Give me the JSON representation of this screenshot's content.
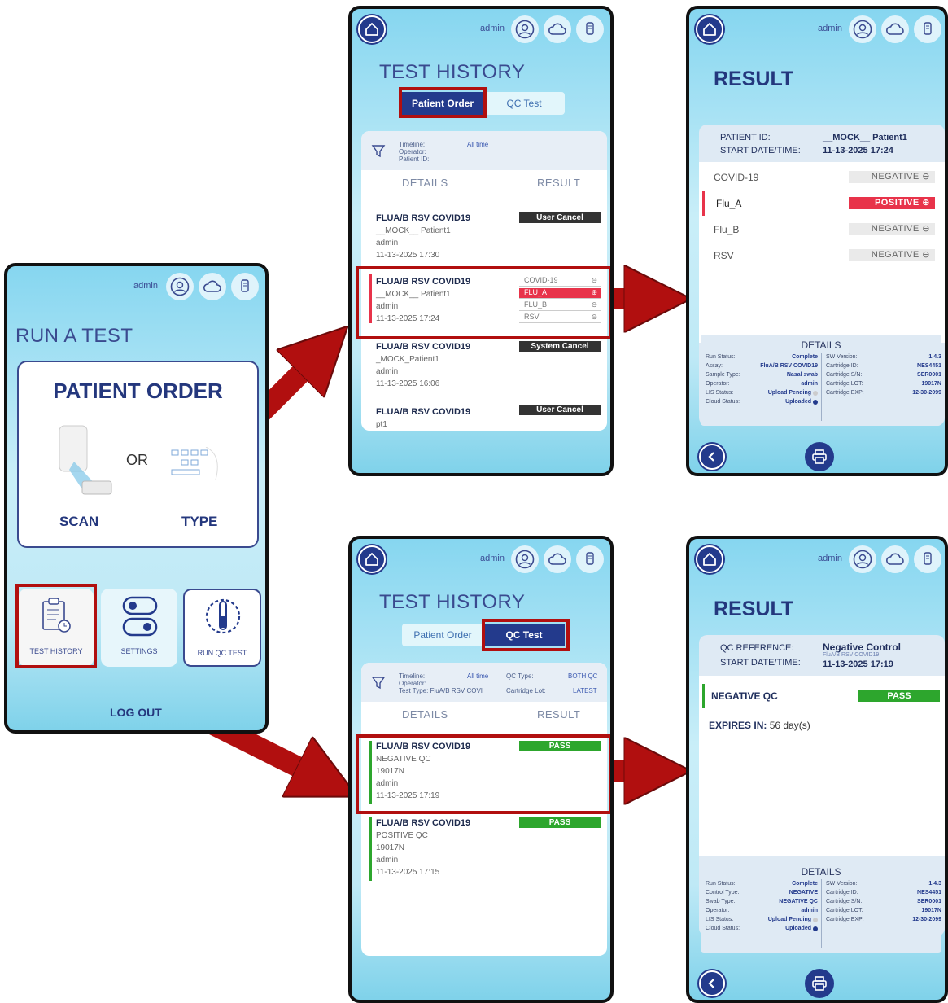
{
  "header": {
    "user": "admin"
  },
  "main_screen": {
    "title": "RUN A TEST",
    "patient_order_title": "PATIENT ORDER",
    "or_label": "OR",
    "scan_label": "SCAN",
    "type_label": "TYPE",
    "tiles": [
      {
        "label": "TEST HISTORY",
        "icon": "clipboard-clock-icon"
      },
      {
        "label": "SETTINGS",
        "icon": "toggles-icon"
      },
      {
        "label": "RUN QC TEST",
        "icon": "tube-timer-icon"
      }
    ],
    "logout": "LOG OUT"
  },
  "history_patient": {
    "title": "TEST HISTORY",
    "tabs": [
      "Patient Order",
      "QC Test"
    ],
    "filter": {
      "timeline_k": "Timeline:",
      "timeline_v": "All time",
      "operator_k": "Operator:",
      "patient_k": "Patient ID:"
    },
    "col_details": "DETAILS",
    "col_result": "RESULT",
    "rows": [
      {
        "assay": "FLUA/B RSV COVID19",
        "patient": "__MOCK__ Patient1",
        "user": "admin",
        "date": "11-13-2025 17:30",
        "result": "User Cancel"
      },
      {
        "assay": "FLUA/B RSV COVID19",
        "patient": "__MOCK__ Patient1",
        "user": "admin",
        "date": "11-13-2025 17:24",
        "mini": [
          {
            "n": "COVID-19",
            "s": "⊖"
          },
          {
            "n": "FLU_A",
            "s": "⊕"
          },
          {
            "n": "FLU_B",
            "s": "⊖"
          },
          {
            "n": "RSV",
            "s": "⊖"
          }
        ]
      },
      {
        "assay": "FLUA/B RSV COVID19",
        "patient": "_MOCK_Patient1",
        "user": "admin",
        "date": "11-13-2025 16:06",
        "result": "System Cancel"
      },
      {
        "assay": "FLUA/B RSV COVID19",
        "patient": "pt1",
        "result": "User Cancel"
      }
    ]
  },
  "result_patient": {
    "title": "RESULT",
    "patient_k": "PATIENT ID:",
    "patient_v": "__MOCK__ Patient1",
    "start_k": "START DATE/TIME:",
    "start_v": "11-13-2025 17:24",
    "targets": [
      {
        "name": "COVID-19",
        "value": "NEGATIVE",
        "sign": "⊖"
      },
      {
        "name": "Flu_A",
        "value": "POSITIVE",
        "sign": "⊕"
      },
      {
        "name": "Flu_B",
        "value": "NEGATIVE",
        "sign": "⊖"
      },
      {
        "name": "RSV",
        "value": "NEGATIVE",
        "sign": "⊖"
      }
    ],
    "details_title": "DETAILS",
    "left": [
      [
        "Run Status:",
        "Complete"
      ],
      [
        "Assay:",
        "FluA/B RSV COVID19"
      ],
      [
        "Sample Type:",
        "Nasal swab"
      ],
      [
        "Operator:",
        "admin"
      ],
      [
        "LIS Status:",
        "Upload Pending"
      ],
      [
        "Cloud Status:",
        "Uploaded"
      ]
    ],
    "right": [
      [
        "SW Version:",
        "1.4.3"
      ],
      [
        "Cartridge ID:",
        "NES4451"
      ],
      [
        "Cartridge S/N:",
        "SER0001"
      ],
      [
        "Cartridge LOT:",
        "19017N"
      ],
      [
        "Cartridge EXP:",
        "12-30-2099"
      ]
    ]
  },
  "history_qc": {
    "title": "TEST HISTORY",
    "tabs": [
      "Patient Order",
      "QC Test"
    ],
    "filter": {
      "timeline_k": "Timeline:",
      "timeline_v": "All time",
      "qctype_k": "QC Type:",
      "qctype_v": "BOTH QC",
      "operator_k": "Operator:",
      "testtype_k": "Test Type: FluA/B RSV COVI",
      "lot_k": "Cartridge Lot:",
      "lot_v": "LATEST"
    },
    "col_details": "DETAILS",
    "col_result": "RESULT",
    "rows": [
      {
        "assay": "FLUA/B RSV COVID19",
        "qc": "NEGATIVE QC",
        "lot": "19017N",
        "user": "admin",
        "date": "11-13-2025 17:19",
        "result": "PASS"
      },
      {
        "assay": "FLUA/B RSV COVID19",
        "qc": "POSITIVE QC",
        "lot": "19017N",
        "user": "admin",
        "date": "11-13-2025 17:15",
        "result": "PASS"
      }
    ]
  },
  "result_qc": {
    "title": "RESULT",
    "ref_k": "QC REFERENCE:",
    "ref_v": "Negative Control",
    "ref_sub": "FluA/B RSV COVID19",
    "start_k": "START DATE/TIME:",
    "start_v": "11-13-2025 17:19",
    "qc_name": "NEGATIVE QC",
    "qc_result": "PASS",
    "expires_k": "EXPIRES IN:",
    "expires_v": "56 day(s)",
    "details_title": "DETAILS",
    "left": [
      [
        "Run Status:",
        "Complete"
      ],
      [
        "Control Type:",
        "NEGATIVE"
      ],
      [
        "Swab Type:",
        "NEGATIVE QC"
      ],
      [
        "Operator:",
        "admin"
      ],
      [
        "LIS Status:",
        "Upload Pending"
      ],
      [
        "Cloud Status:",
        "Uploaded"
      ]
    ],
    "right": [
      [
        "SW Version:",
        "1.4.3"
      ],
      [
        "Cartridge ID:",
        "NES4451"
      ],
      [
        "Cartridge S/N:",
        "SER0001"
      ],
      [
        "Cartridge LOT:",
        "19017N"
      ],
      [
        "Cartridge EXP:",
        "12-30-2099"
      ]
    ]
  },
  "colors": {
    "navy": "#233a8c",
    "red_annotation": "#b10f0f",
    "positive": "#e8334a",
    "pass": "#2da62d"
  }
}
